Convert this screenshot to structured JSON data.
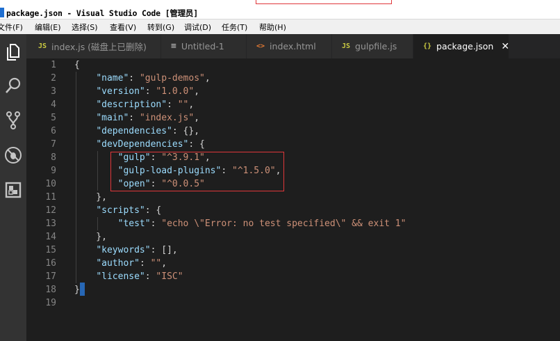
{
  "window": {
    "title": "package.json - Visual Studio Code [管理员]"
  },
  "menu": [
    {
      "label": "文件(F)"
    },
    {
      "label": "编辑(E)"
    },
    {
      "label": "选择(S)"
    },
    {
      "label": "查看(V)"
    },
    {
      "label": "转到(G)"
    },
    {
      "label": "调试(D)"
    },
    {
      "label": "任务(T)"
    },
    {
      "label": "帮助(H)"
    }
  ],
  "activity_bar": [
    "explorer-icon",
    "search-icon",
    "source-control-icon",
    "debug-icon",
    "extensions-icon"
  ],
  "tabs": [
    {
      "icon": "JS",
      "label": "index.js (磁盘上已删除)",
      "active": false
    },
    {
      "icon": "≡",
      "label": "Untitled-1",
      "active": false
    },
    {
      "icon": "<>",
      "label": "index.html",
      "active": false
    },
    {
      "icon": "JS",
      "label": "gulpfile.js",
      "active": false
    },
    {
      "icon": "{}",
      "label": "package.json",
      "active": true,
      "close": "✕"
    }
  ],
  "tab_icon_colors": {
    "JS": "#cbcb41",
    "≡": "#c5c5c5",
    "<>": "#e37933",
    "{}": "#cbcb41"
  },
  "syntax_colors": {
    "punctuation": "#d4d4d4",
    "key": "#9cdcfe",
    "string": "#ce9178",
    "line_number": "#858585"
  },
  "code_lines": [
    {
      "n": "1",
      "tokens": [
        [
          "p",
          "{"
        ]
      ]
    },
    {
      "n": "2",
      "tokens": [
        [
          "p",
          "    "
        ],
        [
          "k",
          "\"name\""
        ],
        [
          "p",
          ": "
        ],
        [
          "s",
          "\"gulp-demos\""
        ],
        [
          "p",
          ","
        ]
      ]
    },
    {
      "n": "3",
      "tokens": [
        [
          "p",
          "    "
        ],
        [
          "k",
          "\"version\""
        ],
        [
          "p",
          ": "
        ],
        [
          "s",
          "\"1.0.0\""
        ],
        [
          "p",
          ","
        ]
      ]
    },
    {
      "n": "4",
      "tokens": [
        [
          "p",
          "    "
        ],
        [
          "k",
          "\"description\""
        ],
        [
          "p",
          ": "
        ],
        [
          "s",
          "\"\""
        ],
        [
          "p",
          ","
        ]
      ]
    },
    {
      "n": "5",
      "tokens": [
        [
          "p",
          "    "
        ],
        [
          "k",
          "\"main\""
        ],
        [
          "p",
          ": "
        ],
        [
          "s",
          "\"index.js\""
        ],
        [
          "p",
          ","
        ]
      ]
    },
    {
      "n": "6",
      "tokens": [
        [
          "p",
          "    "
        ],
        [
          "k",
          "\"dependencies\""
        ],
        [
          "p",
          ": {},"
        ]
      ]
    },
    {
      "n": "7",
      "tokens": [
        [
          "p",
          "    "
        ],
        [
          "k",
          "\"devDependencies\""
        ],
        [
          "p",
          ": {"
        ]
      ]
    },
    {
      "n": "8",
      "tokens": [
        [
          "p",
          "        "
        ],
        [
          "k",
          "\"gulp\""
        ],
        [
          "p",
          ": "
        ],
        [
          "s",
          "\"^3.9.1\""
        ],
        [
          "p",
          ","
        ]
      ]
    },
    {
      "n": "9",
      "tokens": [
        [
          "p",
          "        "
        ],
        [
          "k",
          "\"gulp-load-plugins\""
        ],
        [
          "p",
          ": "
        ],
        [
          "s",
          "\"^1.5.0\""
        ],
        [
          "p",
          ","
        ]
      ]
    },
    {
      "n": "10",
      "tokens": [
        [
          "p",
          "        "
        ],
        [
          "k",
          "\"open\""
        ],
        [
          "p",
          ": "
        ],
        [
          "s",
          "\"^0.0.5\""
        ]
      ]
    },
    {
      "n": "11",
      "tokens": [
        [
          "p",
          "    },"
        ]
      ]
    },
    {
      "n": "12",
      "tokens": [
        [
          "p",
          "    "
        ],
        [
          "k",
          "\"scripts\""
        ],
        [
          "p",
          ": {"
        ]
      ]
    },
    {
      "n": "13",
      "tokens": [
        [
          "p",
          "        "
        ],
        [
          "k",
          "\"test\""
        ],
        [
          "p",
          ": "
        ],
        [
          "s",
          "\"echo \\\"Error: no test specified\\\" && exit 1\""
        ]
      ]
    },
    {
      "n": "14",
      "tokens": [
        [
          "p",
          "    },"
        ]
      ]
    },
    {
      "n": "15",
      "tokens": [
        [
          "p",
          "    "
        ],
        [
          "k",
          "\"keywords\""
        ],
        [
          "p",
          ": [],"
        ]
      ]
    },
    {
      "n": "16",
      "tokens": [
        [
          "p",
          "    "
        ],
        [
          "k",
          "\"author\""
        ],
        [
          "p",
          ": "
        ],
        [
          "s",
          "\"\""
        ],
        [
          "p",
          ","
        ]
      ]
    },
    {
      "n": "17",
      "tokens": [
        [
          "p",
          "    "
        ],
        [
          "k",
          "\"license\""
        ],
        [
          "p",
          ": "
        ],
        [
          "s",
          "\"ISC\""
        ]
      ]
    },
    {
      "n": "18",
      "tokens": [
        [
          "p",
          "}"
        ]
      ]
    },
    {
      "n": "19",
      "tokens": []
    }
  ]
}
